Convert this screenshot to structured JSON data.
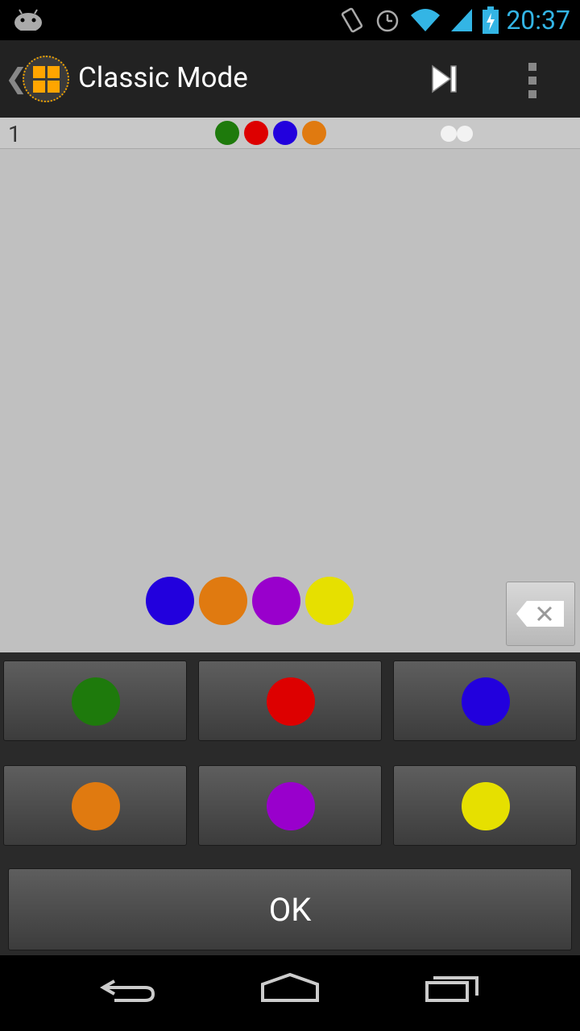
{
  "status_bar": {
    "time": "20:37",
    "icons": [
      "android-notification-icon",
      "vibrate-icon",
      "alarm-icon",
      "wifi-icon",
      "signal-icon",
      "battery-charging-icon"
    ]
  },
  "action_bar": {
    "title": "Classic Mode",
    "icons": [
      "back-chevron-icon",
      "app-logo-icon",
      "skip-next-icon",
      "overflow-menu-icon"
    ]
  },
  "history": [
    {
      "row_number": "1",
      "guess": [
        "#1e7a0c",
        "#dd0000",
        "#2200dd",
        "#e07a10"
      ],
      "feedback": [
        "white",
        "white"
      ]
    }
  ],
  "current_guess": [
    "#2200dd",
    "#e07a10",
    "#9900cc",
    "#e6e000"
  ],
  "palette": [
    {
      "name": "green",
      "color": "#1e7a0c"
    },
    {
      "name": "red",
      "color": "#dd0000"
    },
    {
      "name": "blue",
      "color": "#2200dd"
    },
    {
      "name": "orange",
      "color": "#e07a10"
    },
    {
      "name": "purple",
      "color": "#9900cc"
    },
    {
      "name": "yellow",
      "color": "#e6e000"
    }
  ],
  "ok_label": "OK"
}
